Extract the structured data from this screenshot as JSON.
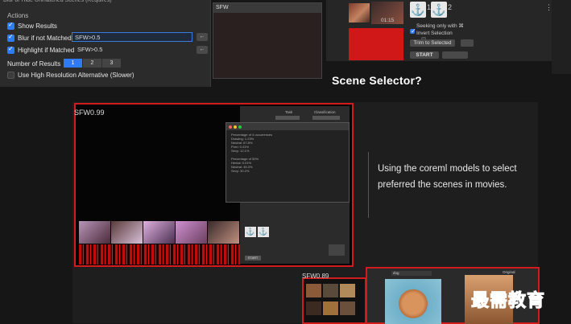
{
  "settings": {
    "cut_title": "Blur or Hide Unmatched Scenes (Requires)",
    "actions_label": "Actions",
    "show_results": {
      "label": "Show Results",
      "checked": true
    },
    "blur_if_not_matched": {
      "label": "Blur if not Matched",
      "checked": true,
      "value": "SFW>0.5"
    },
    "highlight_if_matched": {
      "label": "Highlight if Matched",
      "checked": true,
      "value": "SFW>0.5"
    },
    "number_of_results_label": "Number of Results",
    "number_options": [
      "1",
      "2",
      "3"
    ],
    "number_selected": "1",
    "high_res": {
      "label": "Use High Resolution Alternative (Slower)",
      "checked": false
    },
    "arrow_label": "←"
  },
  "sfw_panel": {
    "title": "SFW"
  },
  "top_right": {
    "thumb_time": "01:15",
    "anchor_1": "⚓",
    "anchor_1_num": "1",
    "anchor_2": "⚓",
    "anchor_2_num": "2",
    "seeking_only": "Seeking only with ⌘",
    "invert_selection": "Invert Selection",
    "trim_to_selected": "Trim to Selected",
    "start": "START",
    "dots": "⋮"
  },
  "slide": {
    "heading": "Scene Selector?",
    "sfw_top_label": "SFW0.99",
    "sfw_lower_label": "SFW0.89",
    "description": "Using the coreml models to select preferred the scenes in movies.",
    "app_window_text": "Percentage of 4 occurrences\nDrawing: 1.23%\nNeutral: 67.8%\nPorn: 0.41%\nSexy: 12.1%\n\nPercentage of 50%\nHentai: 0.01%\nNeutral: 45.3%\nSexy: 30.2%",
    "side_labels": {
      "task": "Task",
      "classification": "Classification",
      "start": "START"
    },
    "search_value": "dog",
    "original_label": "Original"
  },
  "watermark": "最需教育",
  "colors": {
    "accent_blue": "#2f7bf6",
    "highlight_red": "#d01c1c",
    "background": "#161616"
  }
}
